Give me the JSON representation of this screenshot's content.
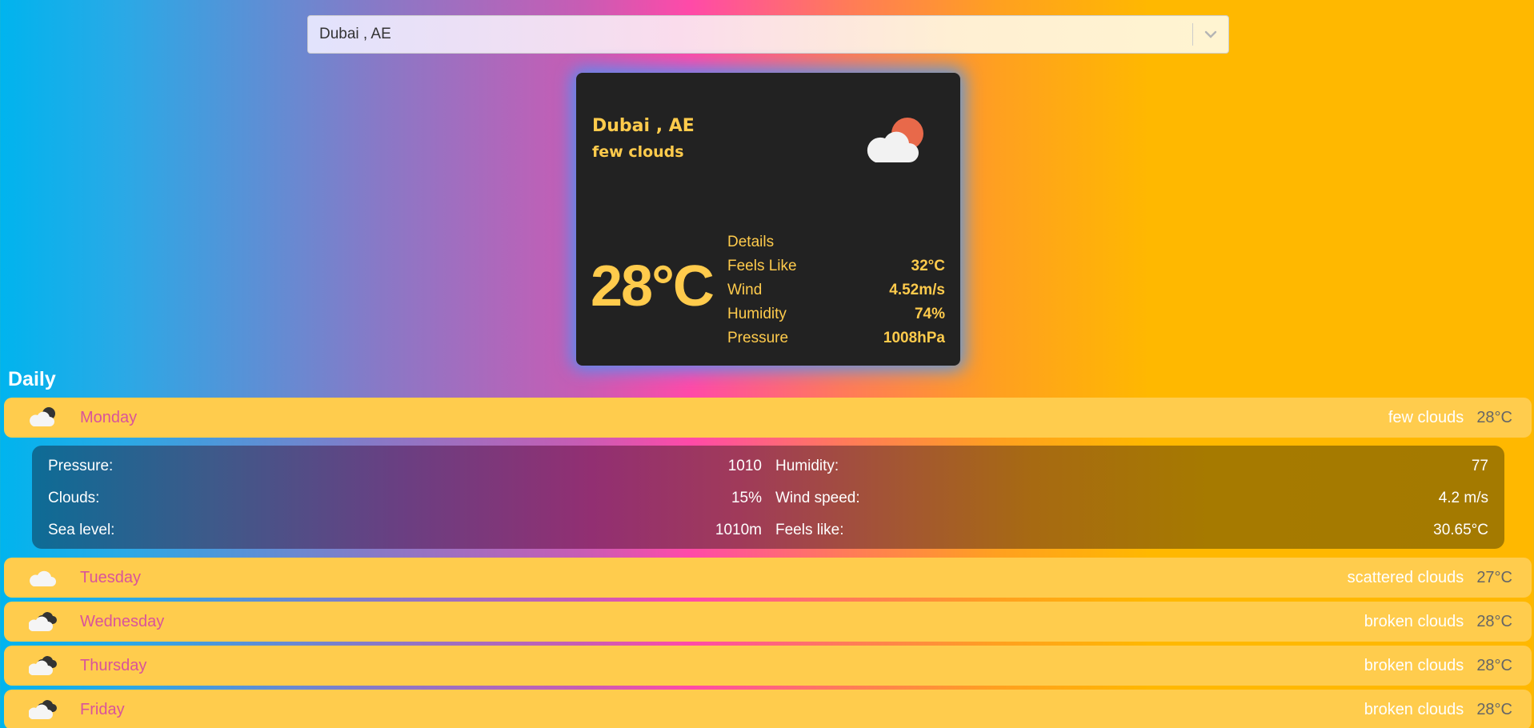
{
  "search": {
    "value": "Dubai , AE"
  },
  "current": {
    "city": "Dubai , AE",
    "description": "few clouds",
    "temperature": "28°C",
    "details_label": "Details",
    "details": [
      {
        "label": "Feels Like",
        "value": "32°C"
      },
      {
        "label": "Wind",
        "value": "4.52m/s"
      },
      {
        "label": "Humidity",
        "value": "74%"
      },
      {
        "label": "Pressure",
        "value": "1008hPa"
      }
    ],
    "icon": "cloud-sun-icon"
  },
  "daily": {
    "title": "Daily",
    "days": [
      {
        "name": "Monday",
        "description": "few clouds",
        "temp": "28°C",
        "icon": "cloud-moon-icon"
      },
      {
        "name": "Tuesday",
        "description": "scattered clouds",
        "temp": "27°C",
        "icon": "cloud-icon"
      },
      {
        "name": "Wednesday",
        "description": "broken clouds",
        "temp": "28°C",
        "icon": "clouds-icon"
      },
      {
        "name": "Thursday",
        "description": "broken clouds",
        "temp": "28°C",
        "icon": "clouds-icon"
      },
      {
        "name": "Friday",
        "description": "broken clouds",
        "temp": "28°C",
        "icon": "clouds-icon"
      }
    ],
    "expanded": {
      "left": [
        {
          "label": "Pressure:",
          "value": "1010"
        },
        {
          "label": "Clouds:",
          "value": "15%"
        },
        {
          "label": "Sea level:",
          "value": "1010m"
        }
      ],
      "right": [
        {
          "label": "Humidity:",
          "value": "77"
        },
        {
          "label": "Wind speed:",
          "value": "4.2 m/s"
        },
        {
          "label": "Feels like:",
          "value": "30.65°C"
        }
      ]
    }
  },
  "colors": {
    "card_bg": "#222222",
    "card_text": "#ffcb4c",
    "day_bg": "#ffcc4d",
    "day_name": "#d9539b"
  }
}
